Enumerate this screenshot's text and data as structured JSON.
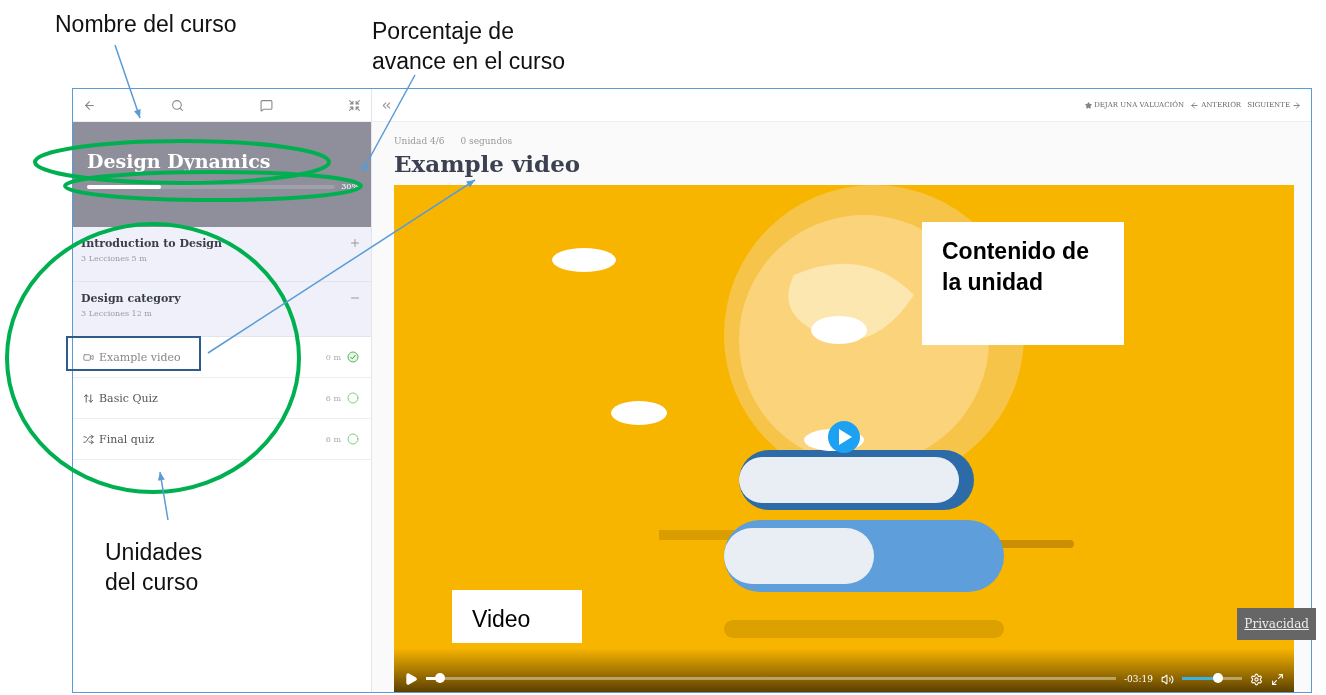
{
  "annotations": [
    {
      "text": "Nombre del curso",
      "kind": "callout"
    },
    {
      "text": "Porcentaje de avance en el curso",
      "kind": "callout"
    },
    {
      "text": "Unidades del curso",
      "kind": "callout"
    },
    {
      "text": "Contenido de la unidad",
      "kind": "box"
    },
    {
      "text": "Video",
      "kind": "box"
    }
  ],
  "sidebar": {
    "course_title": "Design Dynamics",
    "progress": {
      "level": 0.3,
      "reading": "30%"
    },
    "sections": [
      {
        "title": "Introduction to Design",
        "meta": "3 Lecciones  5 m",
        "expanded": false
      },
      {
        "title": "Design category",
        "meta": "3 Lecciones  12 m",
        "expanded": true,
        "children": [
          {
            "title": "Example video",
            "duration": "0 m",
            "kind": "video",
            "completed": true,
            "selected": true
          },
          {
            "title": "Basic Quiz",
            "duration": "6 m",
            "kind": "quiz",
            "completed": false,
            "selected": false
          },
          {
            "title": "Final quiz",
            "duration": "6 m",
            "kind": "shuffle",
            "completed": false,
            "selected": false
          }
        ]
      }
    ]
  },
  "main": {
    "unit": "Unidad 4/6",
    "time": "0 segundos",
    "title": "Example video",
    "actions": [
      {
        "label": "DEJAR UNA VALUACIÓN",
        "kind": "rate"
      },
      {
        "label": "ANTERIOR",
        "kind": "prev"
      },
      {
        "label": "SIGUIENTE",
        "kind": "next"
      }
    ]
  },
  "video": {
    "remaining": "-03:19",
    "progress": {
      "level": 0.02
    },
    "volume": {
      "level": 0.6
    },
    "privacy": "Privacidad"
  }
}
